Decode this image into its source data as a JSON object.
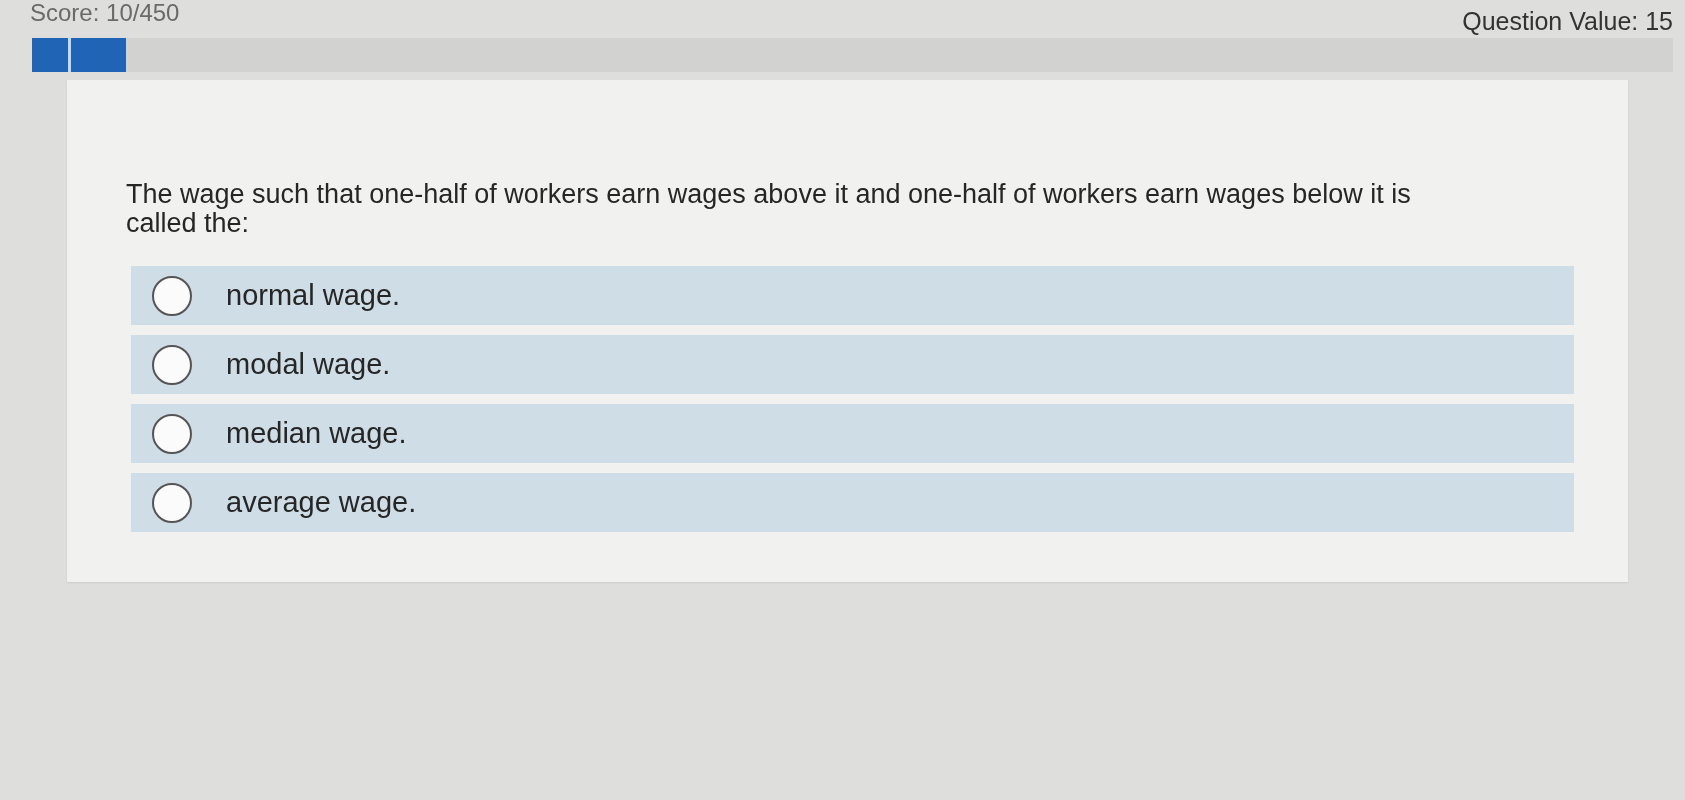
{
  "header": {
    "score": "Score: 10/450",
    "question_value": "Question Value: 15"
  },
  "progress": {
    "level": 0.057
  },
  "question": {
    "prompt": "The wage such that one-half of workers earn wages above it and one-half of workers earn wages below it is called the:",
    "options": [
      {
        "label": "normal wage.",
        "selected": false
      },
      {
        "label": "modal wage.",
        "selected": false
      },
      {
        "label": "median wage.",
        "selected": false
      },
      {
        "label": "average wage.",
        "selected": false
      }
    ]
  }
}
